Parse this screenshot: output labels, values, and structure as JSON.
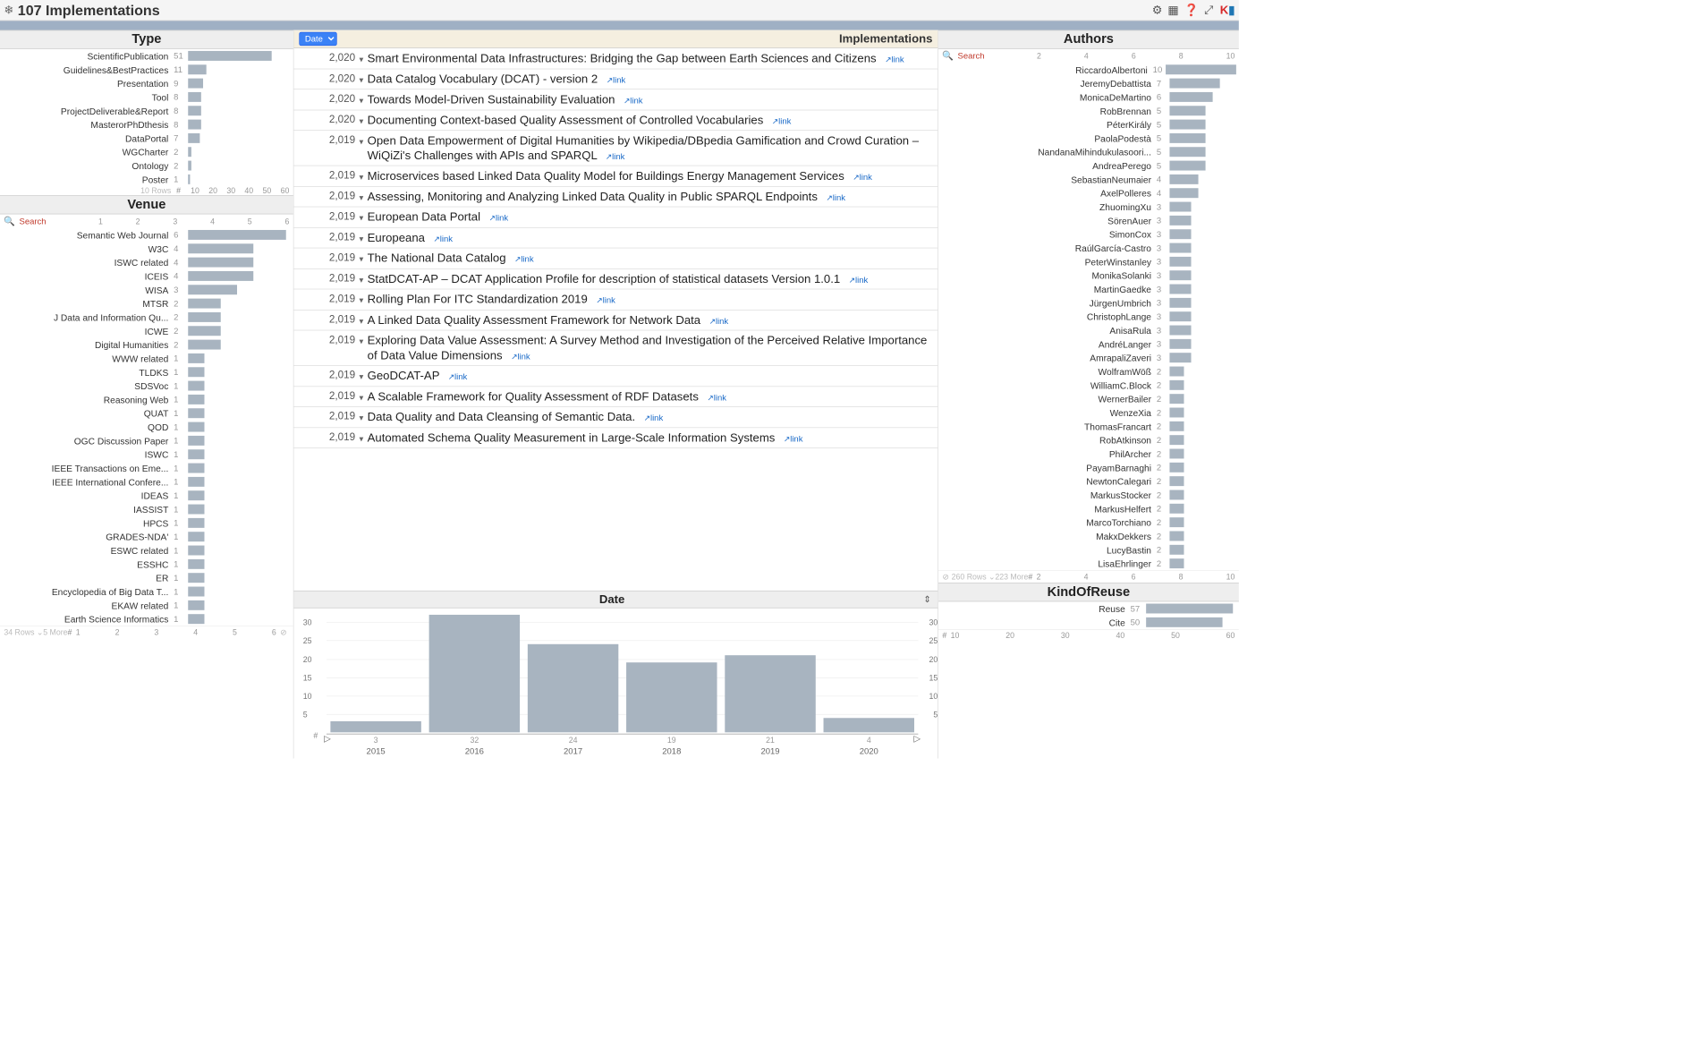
{
  "header": {
    "title": "107 Implementations",
    "icons": [
      "gear-icon",
      "grid-icon",
      "help-icon",
      "expand-icon",
      "logo"
    ]
  },
  "sort_selector": {
    "label": "Date"
  },
  "center_header": "Implementations",
  "type_panel": {
    "title": "Type",
    "rows_label": "10 Rows",
    "hash": "#",
    "ticks": [
      "10",
      "20",
      "30",
      "40",
      "50",
      "60"
    ],
    "items": [
      {
        "label": "ScientificPublication",
        "count": 51
      },
      {
        "label": "Guidelines&BestPractices",
        "count": 11
      },
      {
        "label": "Presentation",
        "count": 9
      },
      {
        "label": "Tool",
        "count": 8
      },
      {
        "label": "ProjectDeliverable&Report",
        "count": 8
      },
      {
        "label": "MasterorPhDthesis",
        "count": 8
      },
      {
        "label": "DataPortal",
        "count": 7
      },
      {
        "label": "WGCharter",
        "count": 2
      },
      {
        "label": "Ontology",
        "count": 2
      },
      {
        "label": "Poster",
        "count": 1
      }
    ]
  },
  "venue_panel": {
    "title": "Venue",
    "search_label": "Search",
    "ticks": [
      "1",
      "2",
      "3",
      "4",
      "5",
      "6"
    ],
    "footer_rows": "34 Rows ⌄5 More",
    "footer_hash": "#",
    "footer_ticks": [
      "1",
      "2",
      "3",
      "4",
      "5",
      "6"
    ],
    "items": [
      {
        "label": "Semantic Web Journal",
        "count": 6
      },
      {
        "label": "W3C",
        "count": 4
      },
      {
        "label": "ISWC related",
        "count": 4
      },
      {
        "label": "ICEIS",
        "count": 4
      },
      {
        "label": "WISA",
        "count": 3
      },
      {
        "label": "MTSR",
        "count": 2
      },
      {
        "label": "J Data and Information Qu...",
        "count": 2
      },
      {
        "label": "ICWE",
        "count": 2
      },
      {
        "label": "Digital Humanities",
        "count": 2
      },
      {
        "label": "WWW related",
        "count": 1
      },
      {
        "label": "TLDKS",
        "count": 1
      },
      {
        "label": "SDSVoc",
        "count": 1
      },
      {
        "label": "Reasoning Web",
        "count": 1
      },
      {
        "label": "QUAT",
        "count": 1
      },
      {
        "label": "QOD",
        "count": 1
      },
      {
        "label": "OGC Discussion Paper",
        "count": 1
      },
      {
        "label": "ISWC",
        "count": 1
      },
      {
        "label": "IEEE Transactions on Eme...",
        "count": 1
      },
      {
        "label": "IEEE International Confere...",
        "count": 1
      },
      {
        "label": "IDEAS",
        "count": 1
      },
      {
        "label": "IASSIST",
        "count": 1
      },
      {
        "label": "HPCS",
        "count": 1
      },
      {
        "label": "GRADES-NDA'",
        "count": 1
      },
      {
        "label": "ESWC related",
        "count": 1
      },
      {
        "label": "ESSHC",
        "count": 1
      },
      {
        "label": "ER",
        "count": 1
      },
      {
        "label": "Encyclopedia of Big Data T...",
        "count": 1
      },
      {
        "label": "EKAW related",
        "count": 1
      },
      {
        "label": "Earth Science Informatics",
        "count": 1
      }
    ]
  },
  "authors_panel": {
    "title": "Authors",
    "search_label": "Search",
    "ticks": [
      "2",
      "4",
      "6",
      "8",
      "10"
    ],
    "footer_rows": "260 Rows ⌄223 More",
    "footer_hash": "#",
    "footer_ticks": [
      "2",
      "4",
      "6",
      "8",
      "10"
    ],
    "items": [
      {
        "label": "RiccardoAlbertoni",
        "count": 10
      },
      {
        "label": "JeremyDebattista",
        "count": 7
      },
      {
        "label": "MonicaDeMartino",
        "count": 6
      },
      {
        "label": "RobBrennan",
        "count": 5
      },
      {
        "label": "PéterKirály",
        "count": 5
      },
      {
        "label": "PaolaPodestà",
        "count": 5
      },
      {
        "label": "NandanaMihindukulasoori...",
        "count": 5
      },
      {
        "label": "AndreaPerego",
        "count": 5
      },
      {
        "label": "SebastianNeumaier",
        "count": 4
      },
      {
        "label": "AxelPolleres",
        "count": 4
      },
      {
        "label": "ZhuomingXu",
        "count": 3
      },
      {
        "label": "SörenAuer",
        "count": 3
      },
      {
        "label": "SimonCox",
        "count": 3
      },
      {
        "label": "RaúlGarcía-Castro",
        "count": 3
      },
      {
        "label": "PeterWinstanley",
        "count": 3
      },
      {
        "label": "MonikaSolanki",
        "count": 3
      },
      {
        "label": "MartinGaedke",
        "count": 3
      },
      {
        "label": "JürgenUmbrich",
        "count": 3
      },
      {
        "label": "ChristophLange",
        "count": 3
      },
      {
        "label": "AnisaRula",
        "count": 3
      },
      {
        "label": "AndréLanger",
        "count": 3
      },
      {
        "label": "AmrapaliZaveri",
        "count": 3
      },
      {
        "label": "WolframWöß",
        "count": 2
      },
      {
        "label": "WilliamC.Block",
        "count": 2
      },
      {
        "label": "WernerBailer",
        "count": 2
      },
      {
        "label": "WenzeXia",
        "count": 2
      },
      {
        "label": "ThomasFrancart",
        "count": 2
      },
      {
        "label": "RobAtkinson",
        "count": 2
      },
      {
        "label": "PhilArcher",
        "count": 2
      },
      {
        "label": "PayamBarnaghi",
        "count": 2
      },
      {
        "label": "NewtonCalegari",
        "count": 2
      },
      {
        "label": "MarkusStocker",
        "count": 2
      },
      {
        "label": "MarkusHelfert",
        "count": 2
      },
      {
        "label": "MarcoTorchiano",
        "count": 2
      },
      {
        "label": "MakxDekkers",
        "count": 2
      },
      {
        "label": "LucyBastin",
        "count": 2
      },
      {
        "label": "LisaEhrlinger",
        "count": 2
      }
    ]
  },
  "reuse_panel": {
    "title": "KindOfReuse",
    "footer_hash": "#",
    "footer_ticks": [
      "10",
      "20",
      "30",
      "40",
      "50",
      "60"
    ],
    "items": [
      {
        "label": "Reuse",
        "count": 57
      },
      {
        "label": "Cite",
        "count": 50
      }
    ]
  },
  "implementations": [
    {
      "year": "2,020",
      "title": "Smart Environmental Data Infrastructures: Bridging the Gap between Earth Sciences and Citizens",
      "link": "link"
    },
    {
      "year": "2,020",
      "title": "Data Catalog Vocabulary (DCAT) - version 2",
      "link": "link"
    },
    {
      "year": "2,020",
      "title": "Towards Model-Driven Sustainability Evaluation",
      "link": "link"
    },
    {
      "year": "2,020",
      "title": "Documenting Context-based Quality Assessment of Controlled Vocabularies",
      "link": "link"
    },
    {
      "year": "2,019",
      "title": "Open Data Empowerment of Digital Humanities by Wikipedia/DBpedia Gamification and Crowd Curation –WiQiZi's Challenges with APIs and SPARQL",
      "link": "link"
    },
    {
      "year": "2,019",
      "title": "Microservices based Linked Data Quality Model for Buildings Energy Management Services",
      "link": "link"
    },
    {
      "year": "2,019",
      "title": "Assessing, Monitoring and Analyzing Linked Data Quality in Public SPARQL Endpoints",
      "link": "link"
    },
    {
      "year": "2,019",
      "title": "European Data Portal",
      "link": "link"
    },
    {
      "year": "2,019",
      "title": "Europeana",
      "link": "link"
    },
    {
      "year": "2,019",
      "title": "The National Data Catalog",
      "link": "link"
    },
    {
      "year": "2,019",
      "title": "StatDCAT-AP – DCAT Application Profile for description of statistical datasets Version 1.0.1",
      "link": "link"
    },
    {
      "year": "2,019",
      "title": "Rolling Plan For ITC Standardization 2019",
      "link": "link"
    },
    {
      "year": "2,019",
      "title": "A Linked Data Quality Assessment Framework for Network Data",
      "link": "link"
    },
    {
      "year": "2,019",
      "title": "Exploring Data Value Assessment: A Survey Method and Investigation of the Perceived Relative Importance of Data Value Dimensions",
      "link": "link"
    },
    {
      "year": "2,019",
      "title": "GeoDCAT-AP",
      "link": "link"
    },
    {
      "year": "2,019",
      "title": "A Scalable Framework for Quality Assessment of RDF Datasets",
      "link": "link"
    },
    {
      "year": "2,019",
      "title": "Data Quality and Data Cleansing of Semantic Data.",
      "link": "link"
    },
    {
      "year": "2,019",
      "title": "Automated Schema Quality Measurement in Large-Scale Information Systems",
      "link": "link"
    }
  ],
  "date_panel": {
    "title": "Date"
  },
  "chart_data": {
    "type": "bar",
    "title": "Date",
    "xlabel": "",
    "ylabel": "",
    "ylim": [
      0,
      32
    ],
    "yticks": [
      5,
      10,
      15,
      20,
      25,
      30
    ],
    "categories": [
      "2015",
      "2016",
      "2017",
      "2018",
      "2019",
      "2020"
    ],
    "values": [
      3,
      32,
      24,
      19,
      21,
      4
    ]
  }
}
